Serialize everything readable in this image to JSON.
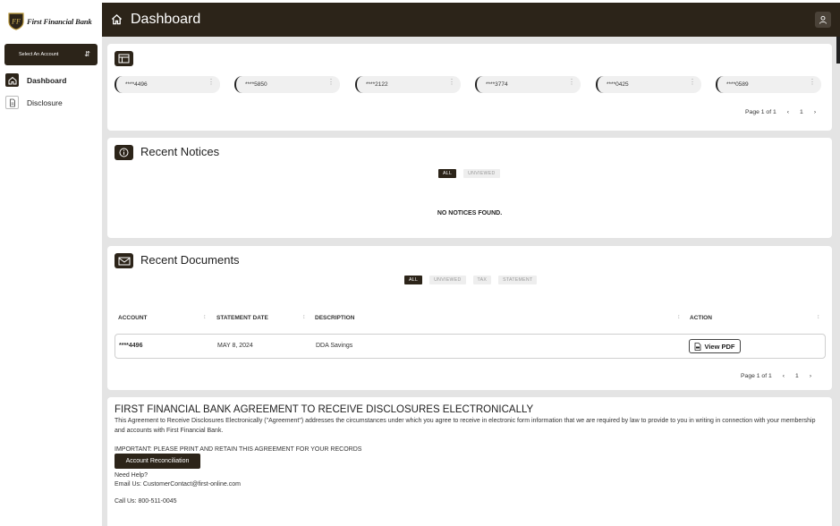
{
  "brand": {
    "name": "First Financial Bank",
    "accent": "#2c2419"
  },
  "sidebar": {
    "account_select": "Select An Account",
    "items": [
      {
        "label": "Dashboard",
        "icon": "home-icon",
        "active": true
      },
      {
        "label": "Disclosure",
        "icon": "document-icon",
        "active": false
      }
    ]
  },
  "header": {
    "title": "Dashboard",
    "user_icon": "user-icon"
  },
  "accounts": {
    "list": [
      "****4496",
      "****5850",
      "****2122",
      "****3774",
      "****0425",
      "****0589"
    ],
    "page_label": "Page 1 of 1",
    "page_number": "1"
  },
  "notices": {
    "title": "Recent Notices",
    "filters": [
      "ALL",
      "UNVIEWED"
    ],
    "empty_text": "NO NOTICES FOUND."
  },
  "documents": {
    "title": "Recent Documents",
    "filters": [
      "ALL",
      "UNVIEWED",
      "TAX",
      "STATEMENT"
    ],
    "columns": [
      "ACCOUNT",
      "STATEMENT DATE",
      "DESCRIPTION",
      "ACTION"
    ],
    "rows": [
      {
        "account": "****4496",
        "date": "MAY 8, 2024",
        "description": "DDA Savings",
        "action": "View PDF"
      }
    ],
    "page_label": "Page 1 of 1",
    "page_number": "1"
  },
  "disclosure": {
    "title": "FIRST FINANCIAL BANK AGREEMENT TO RECEIVE DISCLOSURES ELECTRONICALLY",
    "body": "This Agreement to Receive Disclosures Electronically (\"Agreement\") addresses the circumstances under which you agree to receive in electronic form information that we are required by law to provide to you in writing in connection with your membership and accounts with First Financial Bank.",
    "important": "IMPORTANT: PLEASE PRINT AND RETAIN THIS AGREEMENT FOR YOUR RECORDS",
    "button": "Account Reconciliation",
    "help": "Need Help?",
    "email": "Email Us: CustomerContact@first-online.com",
    "phone": "Call Us: 800-511-0045"
  }
}
